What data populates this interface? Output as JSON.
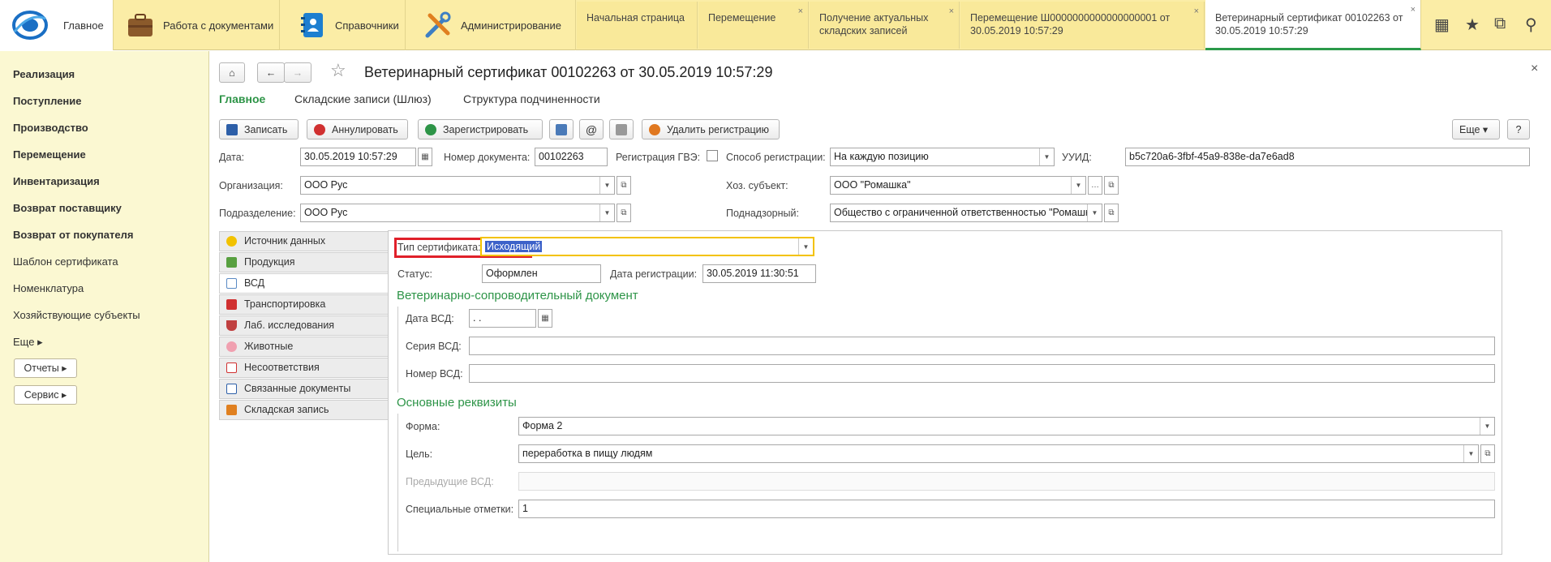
{
  "topbar": {
    "home_label": "Главное",
    "sections": [
      "Работа с документами",
      "Справочники",
      "Администрирование"
    ],
    "tabs": [
      {
        "label": "Начальная страница",
        "closable": false
      },
      {
        "label": "Перемещение",
        "closable": true
      },
      {
        "label": "Получение актуальных складских записей",
        "closable": true
      },
      {
        "label": "Перемещение Ш0000000000000000001 от 30.05.2019 10:57:29",
        "closable": true
      },
      {
        "label": "Ветеринарный сертификат 00102263 от 30.05.2019 10:57:29",
        "closable": true
      }
    ],
    "close_glyph": "×"
  },
  "sidebar": {
    "bold_items": [
      "Реализация",
      "Поступление",
      "Производство",
      "Перемещение",
      "Инвентаризация",
      "Возврат поставщику",
      "Возврат от покупателя"
    ],
    "items": [
      "Шаблон сертификата",
      "Номенклатура",
      "Хозяйствующие субъекты",
      "Еще ▸"
    ],
    "buttons": [
      "Отчеты ▸",
      "Сервис ▸"
    ]
  },
  "doc": {
    "title": "Ветеринарный сертификат 00102263 от 30.05.2019 10:57:29",
    "nav_tabs": [
      "Главное",
      "Складские записи (Шлюз)",
      "Структура подчиненности"
    ],
    "close": "×"
  },
  "toolbar": {
    "save": "Записать",
    "annul": "Аннулировать",
    "register": "Зарегистрировать",
    "delete_reg": "Удалить регистрацию",
    "at": "@",
    "more": "Еще ▾",
    "help": "?"
  },
  "header_fields": {
    "date_label": "Дата:",
    "date_value": "30.05.2019 10:57:29",
    "docnum_label": "Номер документа:",
    "docnum_value": "00102263",
    "gvz_label": "Регистрация ГВЭ:",
    "regmethod_label": "Способ регистрации:",
    "regmethod_value": "На каждую позицию",
    "uuid_label": "УУИД:",
    "uuid_value": "b5c720a6-3fbf-45a9-838e-da7e6ad8",
    "org_label": "Организация:",
    "org_value": "ООО Рус",
    "subj_label": "Хоз. субъект:",
    "subj_value": "ООО \"Ромашка\"",
    "dept_label": "Подразделение:",
    "dept_value": "ООО Рус",
    "supervised_label": "Поднадзорный:",
    "supervised_value": "Общество с ограниченной ответственностью  \"Ромашка\""
  },
  "side_tabs": [
    "Источник данных",
    "Продукция",
    "ВСД",
    "Транспортировка",
    "Лаб. исследования",
    "Животные",
    "Несоответствия",
    "Связанные документы",
    "Складская запись"
  ],
  "vsd": {
    "cert_type_label": "Тип сертификата:",
    "cert_type_value": "Исходящий",
    "status_label": "Статус:",
    "status_value": "Оформлен",
    "regdate_label": "Дата регистрации:",
    "regdate_value": "30.05.2019 11:30:51",
    "group1": "Ветеринарно-сопроводительный документ",
    "vsd_date_label": "Дата ВСД:",
    "vsd_date_value": " .  .",
    "vsd_series_label": "Серия ВСД:",
    "vsd_number_label": "Номер ВСД:",
    "group2": "Основные реквизиты",
    "form_label": "Форма:",
    "form_value": "Форма 2",
    "purpose_label": "Цель:",
    "purpose_value": "переработка в пищу людям",
    "prev_label": "Предыдущие ВСД:",
    "marks_label": "Специальные отметки:",
    "marks_value": "1"
  },
  "colors": {
    "topbar": "#fbeda6",
    "sidebar": "#fbf8d2",
    "accent_green": "#2d9447",
    "highlight_red": "#e0202a",
    "focus_yellow": "#f3c200"
  }
}
